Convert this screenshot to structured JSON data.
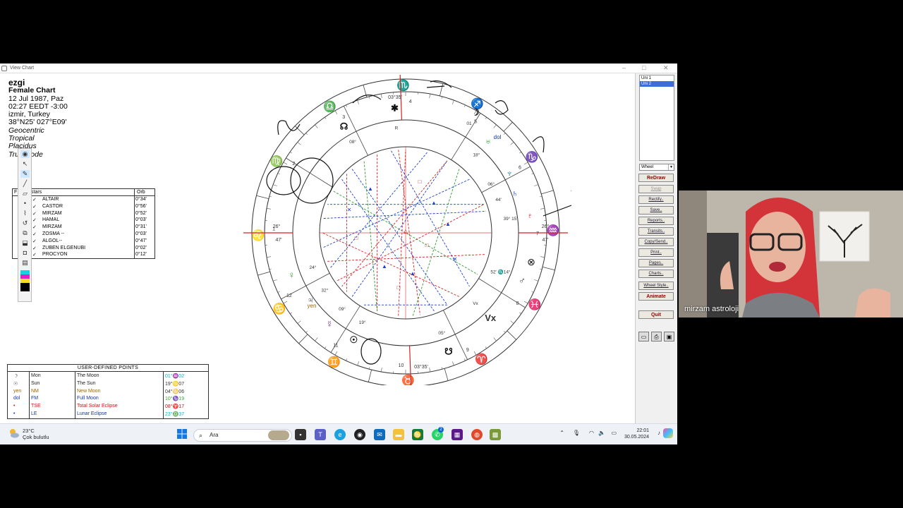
{
  "window": {
    "title": "View Chart"
  },
  "chart_info": {
    "name": "ezgi",
    "type": "Female Chart",
    "date": "12 Jul 1987, Paz",
    "time": "02:27  EEDT -3:00",
    "place": "izmir, Turkey",
    "coords": "38°N25' 027°E09'",
    "mode": "Geocentric",
    "zodiac": "Tropical",
    "houses": "Placidus",
    "node": "True Node"
  },
  "fixed_stars": {
    "header_label": "stars",
    "header_f": "F",
    "header_orb": "Orb",
    "rows": [
      {
        "name": "ALTAIR",
        "orb": "0°34'"
      },
      {
        "name": "CASTOR",
        "orb": "0°56'"
      },
      {
        "name": "MIRZAM",
        "orb": "0°52'"
      },
      {
        "name": "HAMAL",
        "orb": "0°03'"
      },
      {
        "name": "MIRZAM",
        "orb": "0°31'"
      },
      {
        "name": "ZOSMA --",
        "orb": "0°03'"
      },
      {
        "name": "ALGOL--",
        "orb": "0°47'"
      },
      {
        "name": "ZUBEN ELGENUBI",
        "orb": "0°02'"
      },
      {
        "name": "PROCYON",
        "orb": "0°12'"
      }
    ]
  },
  "user_points": {
    "title": "USER-DEFINED POINTS",
    "rows": [
      {
        "glyph": "☽",
        "abbr": "Mon",
        "desc": "The Moon",
        "pos": "01°♒02",
        "color": "#222222",
        "poscolor": "#11aacc"
      },
      {
        "glyph": "☉",
        "abbr": "Sun",
        "desc": "The Sun",
        "pos": "19°♋07",
        "color": "#222222",
        "poscolor": "#333333"
      },
      {
        "glyph": "yen",
        "abbr": "NM",
        "desc": "New Moon",
        "pos": "04°♋06",
        "color": "#996600",
        "poscolor": "#333333"
      },
      {
        "glyph": "dol",
        "abbr": "FM",
        "desc": "Full Moon",
        "pos": "10°♑19",
        "color": "#1133aa",
        "poscolor": "#33aa33"
      },
      {
        "glyph": "•",
        "abbr": "TSE",
        "desc": "Total Solar Eclipse",
        "pos": "08°♈17",
        "color": "#cc1111",
        "poscolor": "#cc1111"
      },
      {
        "glyph": "•",
        "abbr": "LE",
        "desc": "Lunar Eclipse",
        "pos": "23°♎37",
        "color": "#1133aa",
        "poscolor": "#11aacc"
      }
    ]
  },
  "wheel": {
    "house_labels": {
      "h1": "1",
      "h2": "2",
      "h3": "3",
      "h4": "4",
      "h5": "5",
      "h6": "6",
      "h7": "7",
      "h8": "8",
      "h9": "9",
      "h10": "10",
      "h11": "11",
      "h12": "12"
    },
    "cusp_labels": {
      "mc": "03°35'",
      "ic": "03°35'",
      "asc": "26°",
      "asc_min": "47'",
      "dsc": "26°",
      "dsc_min": "47'"
    },
    "planet_labels": {
      "moon_deg": "01",
      "moon_min": "02'",
      "uranus": "18°",
      "neptune": "06°",
      "saturn": "44'",
      "pluto": "39° 15'",
      "mars": "52' ♏14°",
      "venus": "09°",
      "jupiter": "24°",
      "mercury": "32°",
      "sun": "19°",
      "node": "08°",
      "lilith": "05°",
      "yen": "yen",
      "dol": "dol",
      "vx": "Vx",
      "retro": "R"
    }
  },
  "side_panel": {
    "uni_list": [
      "Uni 1",
      "Uni 2"
    ],
    "wheel_select": "Wheel",
    "buttons": [
      "ReDraw",
      "Swap",
      "Rectify..",
      "Save..",
      "Reports..",
      "Transits..",
      "Copy/Send..",
      "Print..",
      "Pages..",
      "Charts..",
      "Wheel Style..",
      "Animate"
    ],
    "quit": "Quit"
  },
  "taskbar": {
    "temp": "23°C",
    "weather": "Çok bulutlu",
    "search": "Ara",
    "time": "22:01",
    "date": "30.05.2024",
    "badge": "2"
  },
  "webcam": {
    "label": "mirzam astroloji"
  },
  "colors": {
    "red": "#d62020",
    "blue": "#1a3fd0",
    "green": "#2a9a2a",
    "cyan": "#1aa8c8"
  }
}
